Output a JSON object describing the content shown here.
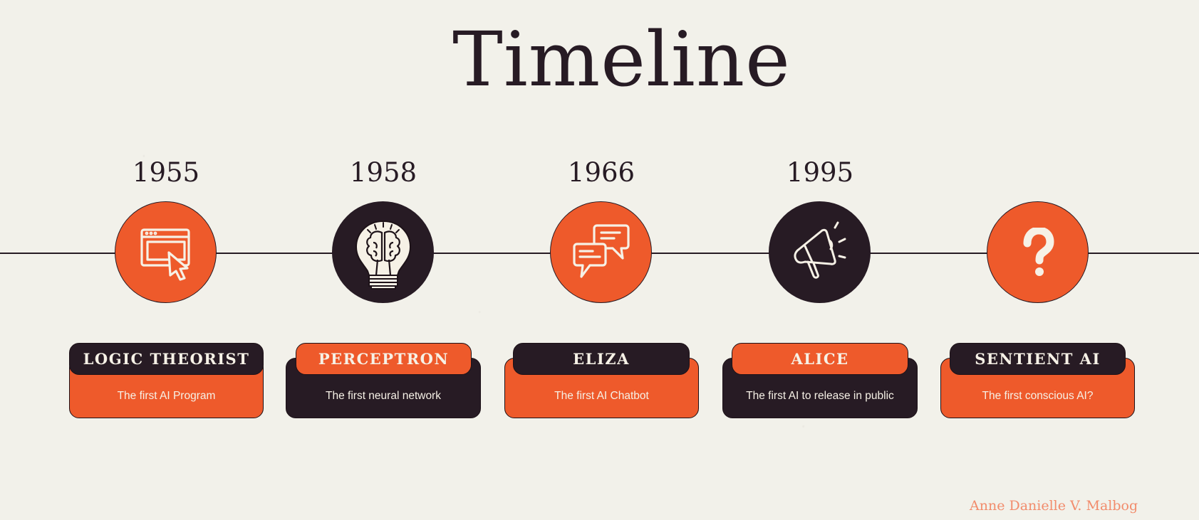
{
  "title": "Timeline",
  "author": "Anne Danielle V. Malbog",
  "colors": {
    "background": "#f2f1ea",
    "orange": "#ee5a2b",
    "dark": "#271b24",
    "cream": "#f6f1e6",
    "author": "#f28c6c"
  },
  "events": [
    {
      "year": "1955",
      "icon": "browser-cursor-icon",
      "circle_color": "orange",
      "label": "LOGIC THEORIST",
      "label_color": "dark",
      "description": "The first AI Program",
      "body_color": "orange"
    },
    {
      "year": "1958",
      "icon": "brain-lightbulb-icon",
      "circle_color": "dark",
      "label": "PERCEPTRON",
      "label_color": "orange",
      "description": "The first neural network",
      "body_color": "dark"
    },
    {
      "year": "1966",
      "icon": "chat-bubbles-icon",
      "circle_color": "orange",
      "label": "ELIZA",
      "label_color": "dark",
      "description": "The first AI Chatbot",
      "body_color": "orange"
    },
    {
      "year": "1995",
      "icon": "megaphone-icon",
      "circle_color": "dark",
      "label": "ALICE",
      "label_color": "orange",
      "description": "The first AI to release in public",
      "body_color": "dark"
    },
    {
      "year": "",
      "icon": "question-mark-icon",
      "circle_color": "orange",
      "label": "SENTIENT AI",
      "label_color": "dark",
      "description": "The first conscious AI?",
      "body_color": "orange"
    }
  ]
}
